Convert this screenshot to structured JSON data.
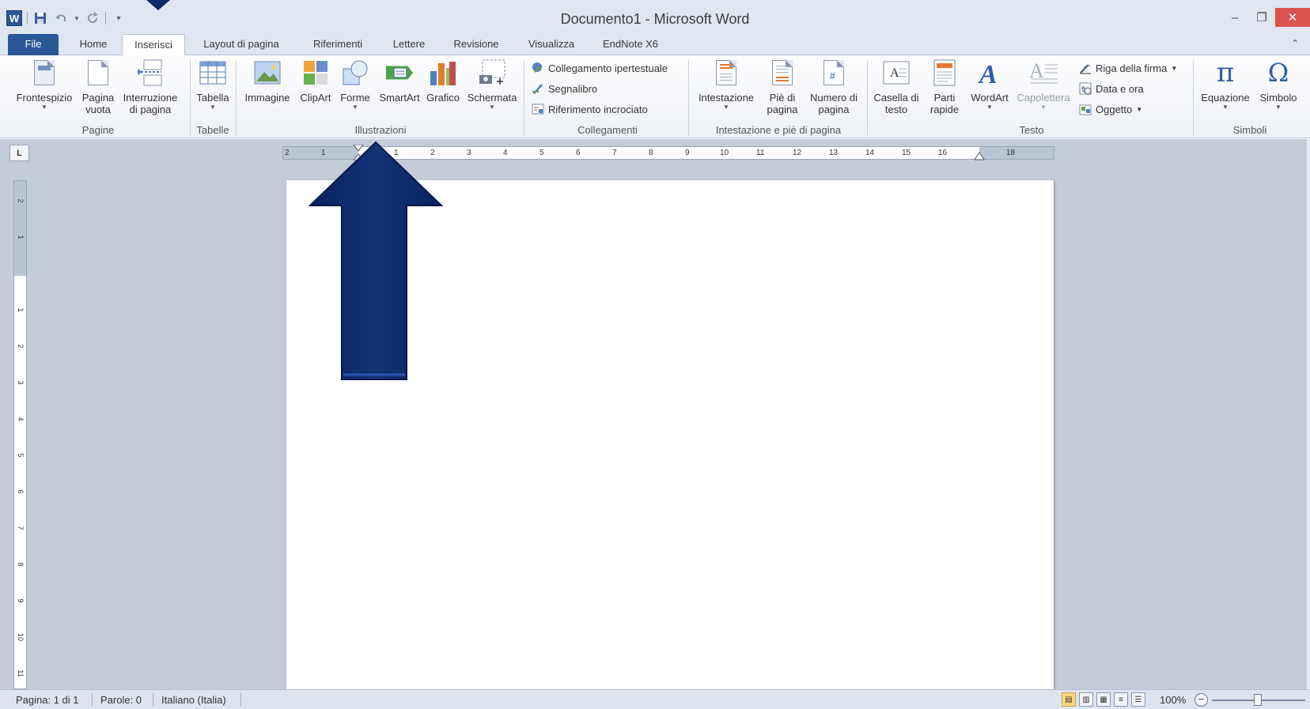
{
  "window": {
    "title": "Documento1 - Microsoft Word"
  },
  "qat": {
    "word_icon": "W",
    "save_icon": "save-icon",
    "undo_icon": "undo-icon",
    "redo_icon": "redo-icon"
  },
  "tabs": [
    "File",
    "Home",
    "Inserisci",
    "Layout di pagina",
    "Riferimenti",
    "Lettere",
    "Revisione",
    "Visualizza",
    "EndNote X6"
  ],
  "active_tab": "Inserisci",
  "ribbon": {
    "pagine": {
      "label": "Pagine",
      "buttons": [
        "Frontespizio",
        "Pagina vuota",
        "Interruzione di pagina"
      ]
    },
    "tabelle": {
      "label": "Tabelle",
      "buttons": [
        "Tabella"
      ]
    },
    "illustrazioni": {
      "label": "Illustrazioni",
      "buttons": [
        "Immagine",
        "ClipArt",
        "Forme",
        "SmartArt",
        "Grafico",
        "Schermata"
      ]
    },
    "collegamenti": {
      "label": "Collegamenti",
      "buttons": [
        "Collegamento ipertestuale",
        "Segnalibro",
        "Riferimento incrociato"
      ]
    },
    "intestazione": {
      "label": "Intestazione e piè di pagina",
      "buttons": [
        "Intestazione",
        "Piè di pagina",
        "Numero di pagina"
      ]
    },
    "testo": {
      "label": "Testo",
      "buttons": [
        "Casella di testo",
        "Parti rapide",
        "WordArt",
        "Capolettera"
      ],
      "small": [
        "Riga della firma",
        "Data e ora",
        "Oggetto"
      ]
    },
    "simboli": {
      "label": "Simboli",
      "buttons": [
        "Equazione",
        "Simbolo"
      ]
    }
  },
  "ruler": {
    "corner": "L",
    "h_ticks": [
      "2",
      "1",
      "1",
      "2",
      "3",
      "4",
      "5",
      "6",
      "7",
      "8",
      "9",
      "10",
      "11",
      "12",
      "13",
      "14",
      "15",
      "16",
      "18"
    ],
    "v_ticks": [
      "2",
      "1",
      "1",
      "2",
      "3",
      "4",
      "5",
      "6",
      "7",
      "8",
      "9",
      "10",
      "11"
    ]
  },
  "status": {
    "page": "Pagina: 1 di 1",
    "words": "Parole: 0",
    "language": "Italiano (Italia)",
    "zoom": "100%"
  },
  "colors": {
    "file_tab": "#2b5797",
    "arrow": "#0d2a66",
    "workspace": "#c4ccd8"
  }
}
